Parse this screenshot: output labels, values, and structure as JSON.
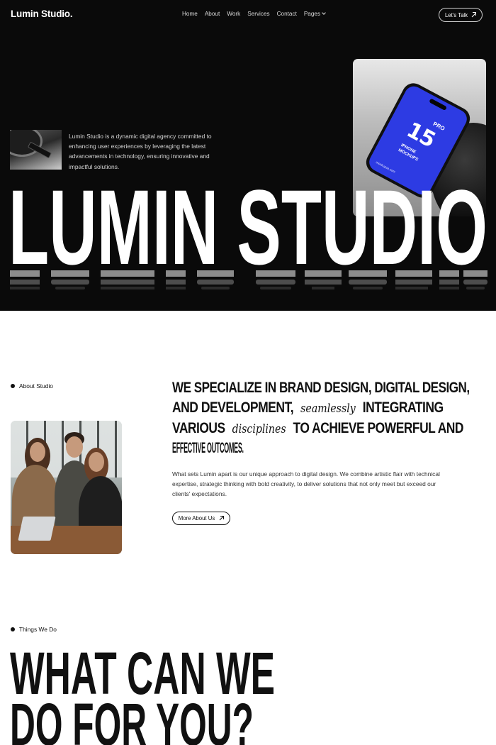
{
  "nav": {
    "logo": "Lumin Studio.",
    "items": [
      "Home",
      "About",
      "Work",
      "Services",
      "Contact",
      "Pages"
    ],
    "cta_label": "Let's Talk"
  },
  "hero": {
    "description": "Lumin Studio is a dynamic digital agency committed to enhancing user experiences by leveraging the latest advancements in technology, ensuring innovative and impactful solutions.",
    "big_title": "LUMIN STUDIO",
    "mockup": {
      "number": "15",
      "badge": "PRO",
      "caption_line1": "IPHONE",
      "caption_line2": "MOCKUPS",
      "url": "mockupza.com"
    }
  },
  "about": {
    "label": "About Studio",
    "headline_lines": [
      [
        "WE SPECIALIZE IN BRAND DESIGN, DIGITAL DESIGN,"
      ],
      [
        "AND DEVELOPMENT,",
        "seamlessly",
        "INTEGRATING"
      ],
      [
        "VARIOUS",
        "disciplines",
        "TO ACHIEVE POWERFUL AND"
      ],
      [
        "EFFECTIVE OUTCOMES."
      ]
    ],
    "body": "What sets Lumin apart is our unique approach to digital design. We combine artistic flair with technical expertise, strategic thinking with bold creativity, to deliver solutions that not only meet but exceed our clients' expectations.",
    "button_label": "More About Us"
  },
  "services": {
    "label": "Things We Do",
    "title_line1": "WHAT CAN WE",
    "title_line2": "DO FOR YOU?"
  },
  "colors": {
    "hero_bg": "#0a0a0a",
    "text_dark": "#111111",
    "phone_screen": "#2d3be3"
  }
}
